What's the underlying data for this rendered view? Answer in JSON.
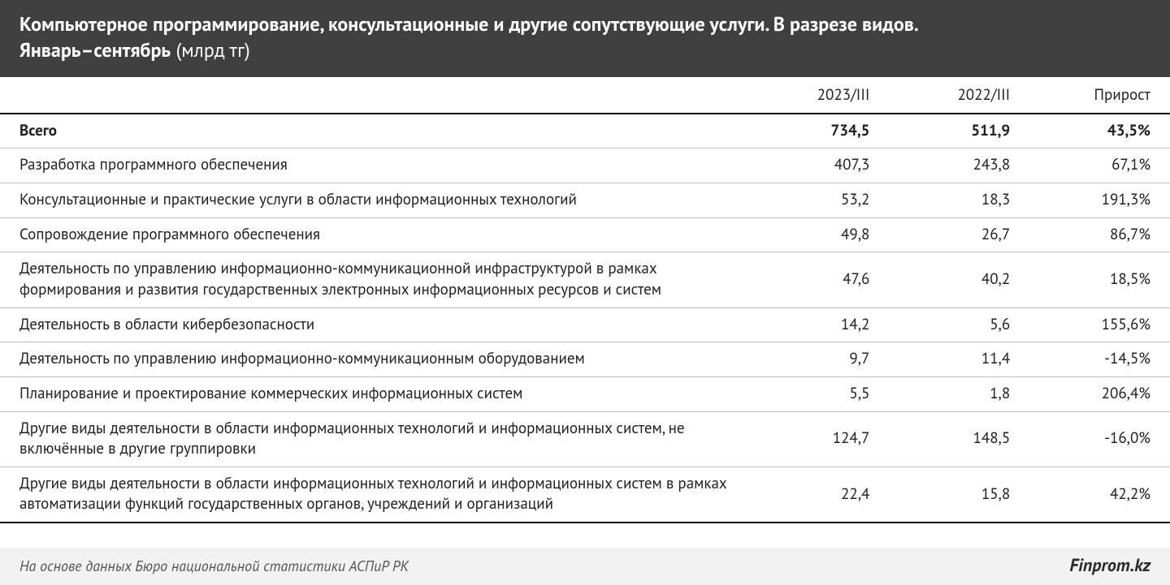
{
  "title": {
    "line1": "Компьютерное программирование, консультационные и другие сопутствующие услуги. В разрезе видов.",
    "line2_bold": "Январь–сентябрь",
    "unit": " (млрд тг)"
  },
  "chart_data": {
    "type": "table",
    "columns": [
      "",
      "2023/III",
      "2022/III",
      "Прирост"
    ],
    "total": {
      "label": "Всего",
      "v2023": "734,5",
      "v2022": "511,9",
      "growth": "43,5%"
    },
    "rows": [
      {
        "label": "Разработка программного обеспечения",
        "v2023": "407,3",
        "v2022": "243,8",
        "growth": "67,1%"
      },
      {
        "label": "Консультационные и практические услуги в области информационных технологий",
        "v2023": "53,2",
        "v2022": "18,3",
        "growth": "191,3%"
      },
      {
        "label": "Сопровождение программного обеспечения",
        "v2023": "49,8",
        "v2022": "26,7",
        "growth": "86,7%"
      },
      {
        "label": "Деятельность по управлению информационно-коммуникационной инфраструктурой  в рамках формирования и развития государственных электронных информационных ресурсов и систем",
        "v2023": "47,6",
        "v2022": "40,2",
        "growth": "18,5%"
      },
      {
        "label": "Деятельность в области кибербезопасности",
        "v2023": "14,2",
        "v2022": "5,6",
        "growth": "155,6%"
      },
      {
        "label": "Деятельность по управлению информационно-коммуникационным оборудованием",
        "v2023": "9,7",
        "v2022": "11,4",
        "growth": "-14,5%"
      },
      {
        "label": "Планирование и проектирование коммерческих информационных систем",
        "v2023": "5,5",
        "v2022": "1,8",
        "growth": "206,4%"
      },
      {
        "label": "Другие виды деятельности в области информационных технологий и информационных систем, не включённые в другие группировки",
        "v2023": "124,7",
        "v2022": "148,5",
        "growth": "-16,0%"
      },
      {
        "label": "Другие виды деятельности в области информационных технологий и информационных систем в рамках автоматизации функций государственных органов, учреждений и организаций",
        "v2023": "22,4",
        "v2022": "15,8",
        "growth": "42,2%"
      }
    ]
  },
  "footer": {
    "source": "На основе данных Бюро национальной статистики АСПиР РК",
    "brand": "Finprom.kz"
  }
}
